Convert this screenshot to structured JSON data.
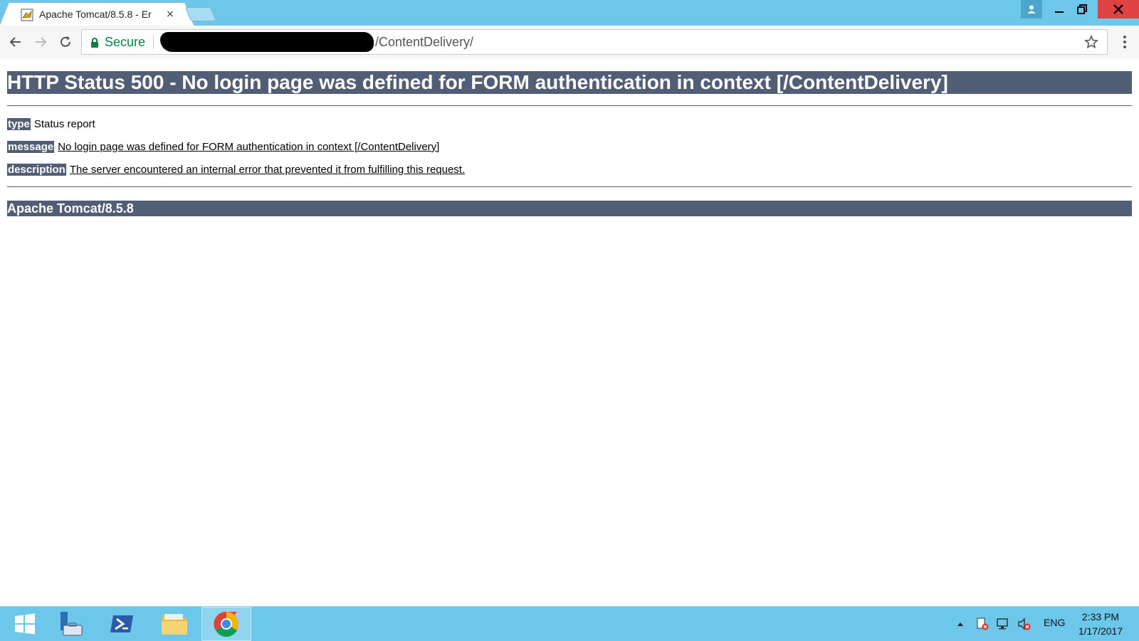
{
  "browser": {
    "tab_title": "Apache Tomcat/8.5.8 - Er",
    "tab_close": "×",
    "secure_label": "Secure",
    "url_path": "/ContentDelivery/"
  },
  "page": {
    "heading": "HTTP Status 500 - No login page was defined for FORM authentication in context [/ContentDelivery]",
    "rows": [
      {
        "label": "type",
        "value": "Status report"
      },
      {
        "label": "message",
        "value": "No login page was defined for FORM authentication in context [/ContentDelivery]"
      },
      {
        "label": "description",
        "value": "The server encountered an internal error that prevented it from fulfilling this request."
      }
    ],
    "footer": "Apache Tomcat/8.5.8"
  },
  "taskbar": {
    "lang": "ENG",
    "time": "2:33 PM",
    "date": "1/17/2017"
  },
  "colors": {
    "tomcat_bar": "#525d76",
    "chrome_frame": "#6cc7eb",
    "secure_green": "#0b8043",
    "close_red": "#e04343"
  }
}
